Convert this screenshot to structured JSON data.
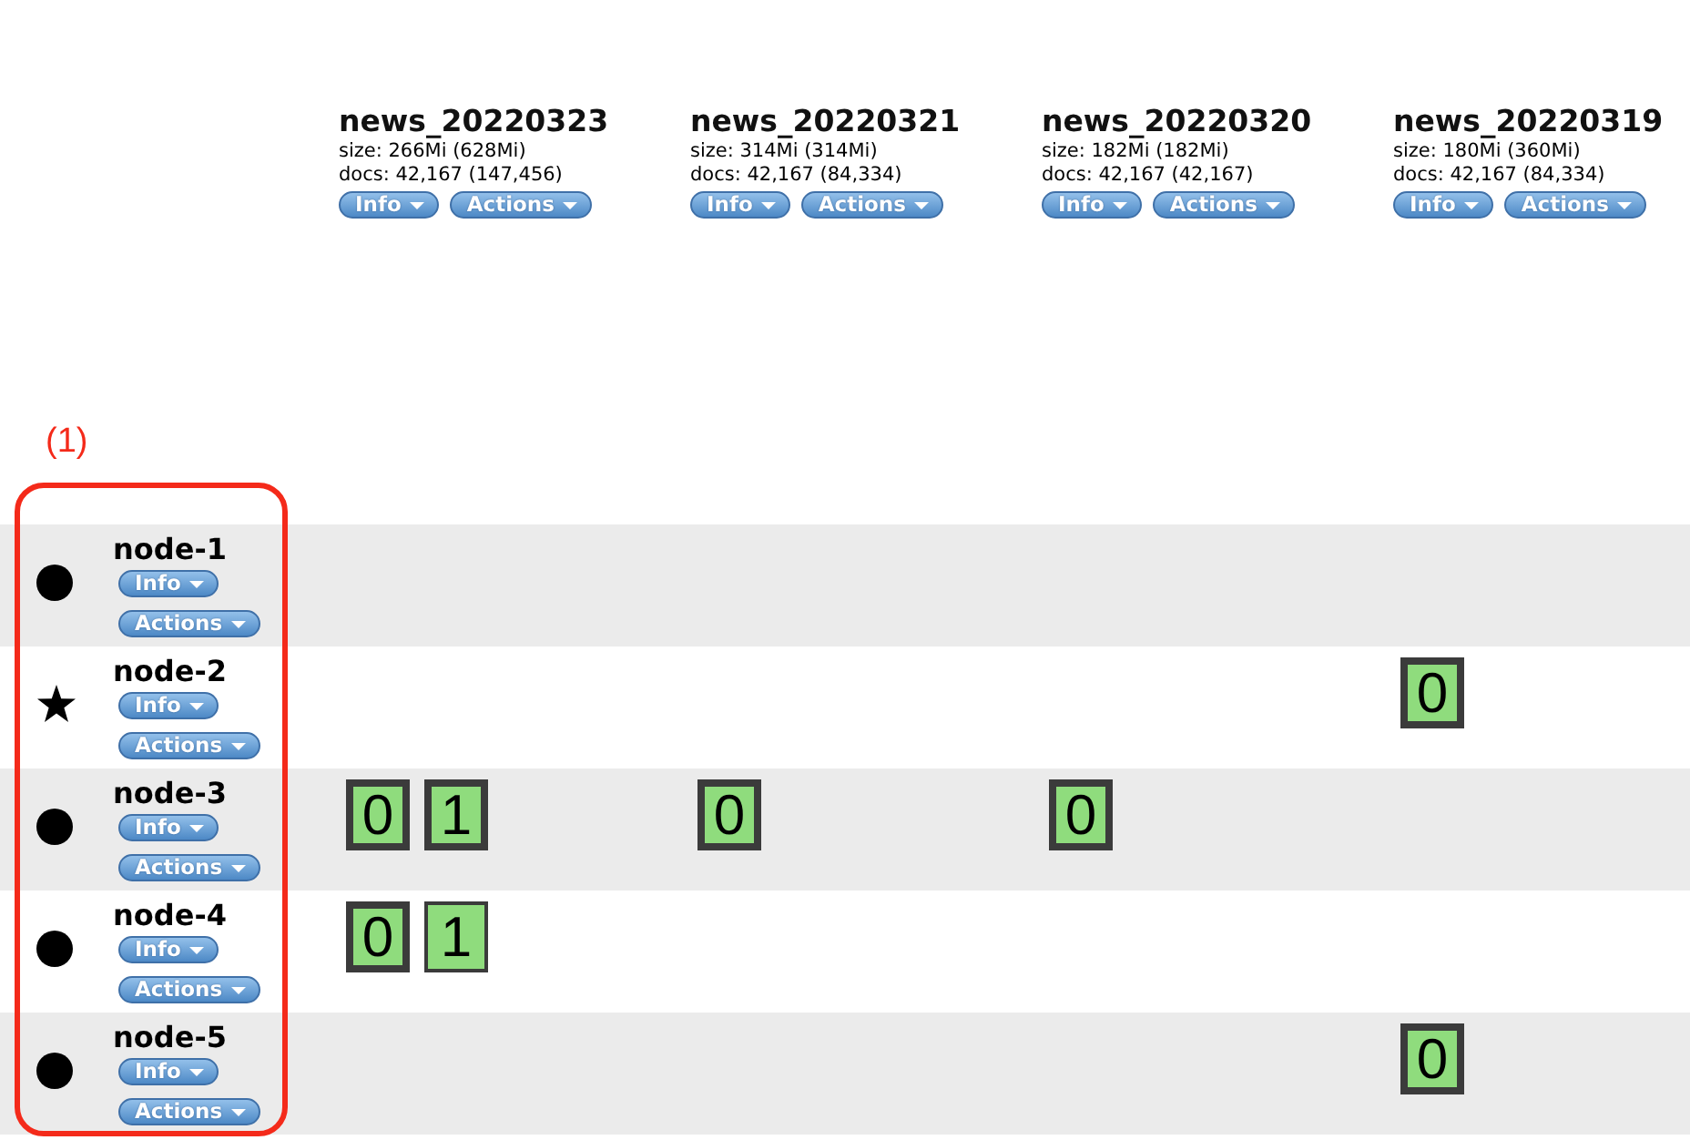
{
  "columns": [
    {
      "name": "news_20220323",
      "size": "size: 266Mi (628Mi)",
      "docs": "docs: 42,167 (147,456)",
      "buttons": [
        "Info",
        "Actions"
      ]
    },
    {
      "name": "news_20220321",
      "size": "size: 314Mi (314Mi)",
      "docs": "docs: 42,167 (84,334)",
      "buttons": [
        "Info",
        "Actions"
      ]
    },
    {
      "name": "news_20220320",
      "size": "size: 182Mi (182Mi)",
      "docs": "docs: 42,167 (42,167)",
      "buttons": [
        "Info",
        "Actions"
      ]
    },
    {
      "name": "news_20220319",
      "size": "size: 180Mi (360Mi)",
      "docs": "docs: 42,167 (84,334)",
      "buttons": [
        "Info",
        "Actions"
      ]
    }
  ],
  "annotation": {
    "label": "(1)"
  },
  "nodes": [
    {
      "name": "node-1",
      "master": false,
      "buttons": [
        "Info",
        "Actions"
      ]
    },
    {
      "name": "node-2",
      "master": true,
      "buttons": [
        "Info",
        "Actions"
      ],
      "cells": [
        {},
        {},
        {},
        {
          "shards": [
            {
              "label": "0",
              "primary": true
            }
          ]
        }
      ]
    },
    {
      "name": "node-3",
      "master": false,
      "buttons": [
        "Info",
        "Actions"
      ],
      "cells": [
        {
          "shards": [
            {
              "label": "0",
              "primary": true
            },
            {
              "label": "1",
              "primary": true
            }
          ]
        },
        {
          "shards": [
            {
              "label": "0",
              "primary": true
            }
          ]
        },
        {
          "shards": [
            {
              "label": "0",
              "primary": true
            }
          ]
        },
        {}
      ]
    },
    {
      "name": "node-4",
      "master": false,
      "buttons": [
        "Info",
        "Actions"
      ],
      "cells": [
        {
          "shards": [
            {
              "label": "0",
              "primary": true
            },
            {
              "label": "1",
              "primary": false
            }
          ]
        },
        {},
        {},
        {}
      ]
    },
    {
      "name": "node-5",
      "master": false,
      "buttons": [
        "Info",
        "Actions"
      ],
      "cells": [
        {},
        {},
        {},
        {
          "shards": [
            {
              "label": "0",
              "primary": true
            }
          ]
        }
      ]
    }
  ]
}
